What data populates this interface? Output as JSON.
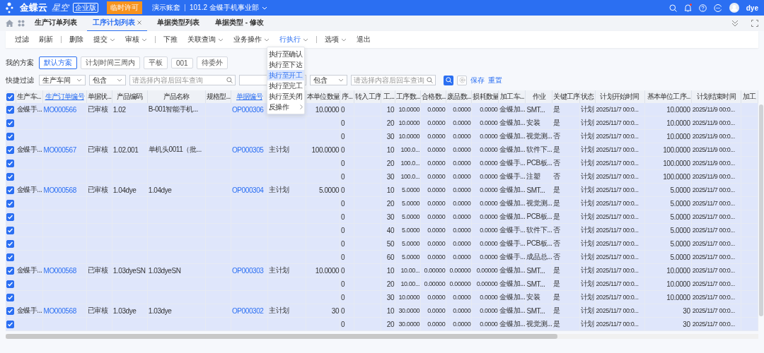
{
  "top_bar": {
    "product": "金蝶云",
    "edition": "星空",
    "badge": "企业版",
    "license_button": "临时许可",
    "account": "演示账套",
    "org": "101.2 金蝶手机事业部",
    "user": "dye",
    "notification_dot": true
  },
  "tabs": [
    {
      "label": "生产订单列表",
      "selected": false,
      "closable": false
    },
    {
      "label": "工序计划列表",
      "selected": true,
      "closable": true
    },
    {
      "label": "单据类型列表",
      "selected": false,
      "closable": false
    },
    {
      "label": "单据类型 - 修改",
      "selected": false,
      "closable": false
    }
  ],
  "toolbar": [
    {
      "kind": "button",
      "label": "过滤",
      "dropdown": false,
      "active": false
    },
    {
      "kind": "button",
      "label": "刷新",
      "dropdown": false,
      "active": false
    },
    {
      "kind": "separator"
    },
    {
      "kind": "button",
      "label": "删除",
      "dropdown": false,
      "active": false
    },
    {
      "kind": "button",
      "label": "提交",
      "dropdown": true,
      "active": false
    },
    {
      "kind": "button",
      "label": "审核",
      "dropdown": true,
      "active": false
    },
    {
      "kind": "separator"
    },
    {
      "kind": "button",
      "label": "下推",
      "dropdown": false,
      "active": false
    },
    {
      "kind": "button",
      "label": "关联查询",
      "dropdown": true,
      "active": false
    },
    {
      "kind": "button",
      "label": "业务操作",
      "dropdown": true,
      "active": false
    },
    {
      "kind": "button",
      "label": "行执行",
      "dropdown": true,
      "active": true
    },
    {
      "kind": "separator"
    },
    {
      "kind": "button",
      "label": "选项",
      "dropdown": true,
      "active": false
    },
    {
      "kind": "button",
      "label": "退出",
      "dropdown": false,
      "active": false
    }
  ],
  "dropdown_menu": {
    "items": [
      {
        "label": "执行至确认",
        "selected": false
      },
      {
        "label": "执行至下达",
        "selected": false
      },
      {
        "label": "执行至开工",
        "selected": true
      },
      {
        "label": "执行至完工",
        "selected": false
      },
      {
        "label": "执行至关闭",
        "selected": false
      },
      {
        "label": "反操作",
        "selected": false,
        "submenu": true
      }
    ]
  },
  "schemes": {
    "label": "我的方案",
    "items": [
      {
        "label": "默认方案",
        "selected": true
      },
      {
        "label": "计划时间三周内",
        "selected": false
      },
      {
        "label": "平板",
        "selected": false
      },
      {
        "label": "001",
        "selected": false
      },
      {
        "label": "待委外",
        "selected": false
      }
    ]
  },
  "quick_filter": {
    "label": "快捷过滤",
    "conditions": [
      {
        "field": "生产车间",
        "operator": "包含",
        "placeholder": "请选择内容后回车查询"
      },
      {
        "operator": "包含",
        "placeholder": "请选择内容后回车查询"
      }
    ],
    "save": "保存",
    "reset": "重置"
  },
  "table": {
    "all_checked": true,
    "columns": [
      {
        "label": "生产车..."
      },
      {
        "label": "生产订单编号",
        "link": true
      },
      {
        "label": "单据状..."
      },
      {
        "label": "产品编码"
      },
      {
        "label": "产品名称"
      },
      {
        "label": "规格型..."
      },
      {
        "label": "单据编号",
        "link": true
      },
      {},
      {
        "label": "本单位数量"
      },
      {
        "label": "序..."
      },
      {
        "label": "转入工序"
      },
      {
        "label": "工..."
      },
      {
        "label": "工序数..."
      },
      {
        "label": "合格数..."
      },
      {
        "label": "废品数..."
      },
      {
        "label": "损耗数量"
      },
      {
        "label": "加工车..."
      },
      {
        "label": "作业"
      },
      {
        "label": "关键工序"
      },
      {
        "label": "状态"
      },
      {
        "label": "计划开始时间"
      },
      {
        "label": "基本单位工序..."
      },
      {
        "label": "计划结束时间"
      },
      {
        "label": "加工"
      }
    ],
    "rows": [
      {
        "checked": true,
        "cells": [
          "金蝶手...",
          "MO000566",
          "已审核",
          "1.02",
          "B-001智能手机...",
          null,
          "OP000306",
          null,
          "10.0000",
          "0",
          null,
          "10",
          "10.0000",
          "0.0000",
          "0.0000",
          "0.0000",
          "金蝶加...",
          "SMT...",
          "是",
          "计划",
          "2025/11/7 00:0...",
          "10.0000",
          "2025/11/9 00:0..."
        ]
      },
      {
        "checked": true,
        "cells": [
          null,
          null,
          null,
          null,
          null,
          null,
          null,
          null,
          null,
          "0",
          null,
          "20",
          "10.0000",
          "0.0000",
          "0.0000",
          "0.0000",
          "金蝶加...",
          "安装",
          "是",
          "计划",
          "2025/11/7 00:0...",
          "10.0000",
          "2025/11/9 00:0..."
        ]
      },
      {
        "checked": true,
        "cells": [
          null,
          null,
          null,
          null,
          null,
          null,
          null,
          null,
          null,
          "0",
          null,
          "30",
          "10.0000",
          "0.0000",
          "0.0000",
          "0.0000",
          "金蝶加...",
          "视觉测...",
          "否",
          "计划",
          "2025/11/7 00:0...",
          "10.0000",
          "2025/11/9 00:0..."
        ]
      },
      {
        "checked": true,
        "cells": [
          "金蝶手...",
          "MO000567",
          "已审核",
          "1.02.001",
          "单机头0011（批...",
          null,
          "OP000305",
          "主计划",
          "100.0000",
          "0",
          null,
          "10",
          "100.0...",
          "0.0000",
          "0.0000",
          "0.0000",
          "金蝶加...",
          "软件下...",
          "是",
          "计划",
          "2025/11/7 00:0...",
          "100.0000",
          "2025/11/9 00:0..."
        ]
      },
      {
        "checked": true,
        "cells": [
          null,
          null,
          null,
          null,
          null,
          null,
          null,
          null,
          null,
          "0",
          null,
          "20",
          "100.0...",
          "0.0000",
          "0.0000",
          "0.0000",
          "金蝶手...",
          "PCB板...",
          "否",
          "计划",
          "2025/11/7 00:0...",
          "100.0000",
          "2025/11/9 00:0..."
        ]
      },
      {
        "checked": true,
        "cells": [
          null,
          null,
          null,
          null,
          null,
          null,
          null,
          null,
          null,
          "0",
          null,
          "30",
          "100.0...",
          "0.0000",
          "0.0000",
          "0.0000",
          "金蝶手...",
          "注塑",
          "否",
          "计划",
          "2025/11/7 00:0...",
          "100.0000",
          "2025/11/9 00:0..."
        ]
      },
      {
        "checked": true,
        "cells": [
          "金蝶手...",
          "MO000568",
          "已审核",
          "1.04dye",
          "1.04dye",
          null,
          "OP000304",
          "主计划",
          "5.0000",
          "0",
          null,
          "10",
          "5.0000",
          "0.0000",
          "0.0000",
          "0.0000",
          "金蝶加...",
          "SMT...",
          "是",
          "计划",
          "2025/11/7 00:0...",
          "5.0000",
          "2025/11/7 00:0..."
        ]
      },
      {
        "checked": true,
        "cells": [
          null,
          null,
          null,
          null,
          null,
          null,
          null,
          null,
          null,
          "0",
          null,
          "20",
          "5.0000",
          "0.0000",
          "0.0000",
          "0.0000",
          "金蝶加...",
          "视觉测...",
          "是",
          "计划",
          "2025/11/7 00:0...",
          "5.0000",
          "2025/11/7 00:0..."
        ]
      },
      {
        "checked": true,
        "cells": [
          null,
          null,
          null,
          null,
          null,
          null,
          null,
          null,
          null,
          "0",
          null,
          "30",
          "5.0000",
          "0.0000",
          "0.0000",
          "0.0000",
          "金蝶加...",
          "PCB板...",
          "是",
          "计划",
          "2025/11/7 00:0...",
          "5.0000",
          "2025/11/7 00:0..."
        ]
      },
      {
        "checked": true,
        "cells": [
          null,
          null,
          null,
          null,
          null,
          null,
          null,
          null,
          null,
          "0",
          null,
          "40",
          "5.0000",
          "0.0000",
          "0.0000",
          "0.0000",
          "金蝶手...",
          "软件下...",
          "否",
          "计划",
          "2025/11/7 00:0...",
          "5.0000",
          "2025/11/7 00:0..."
        ]
      },
      {
        "checked": true,
        "cells": [
          null,
          null,
          null,
          null,
          null,
          null,
          null,
          null,
          null,
          "0",
          null,
          "50",
          "5.0000",
          "0.0000",
          "0.0000",
          "0.0000",
          "金蝶手...",
          "PCB板...",
          "否",
          "计划",
          "2025/11/7 00:0...",
          "5.0000",
          "2025/11/7 00:0..."
        ]
      },
      {
        "checked": true,
        "cells": [
          null,
          null,
          null,
          null,
          null,
          null,
          null,
          null,
          null,
          "0",
          null,
          "60",
          "5.0000",
          "0.0000",
          "0.0000",
          "0.0000",
          "金蝶手...",
          "成品总...",
          "否",
          "计划",
          "2025/11/7 00:0...",
          "5.0000",
          "2025/11/7 00:0..."
        ]
      },
      {
        "checked": true,
        "cells": [
          "金蝶手...",
          "MO000568",
          "已审核",
          "1.03dyeSN",
          "1.03dyeSN",
          null,
          "OP000303",
          "主计划",
          "10.0000",
          "0",
          null,
          "10",
          "10.00...",
          "0.00000",
          "0.00000",
          "0.00000",
          "金蝶加...",
          "SMT...",
          "是",
          "计划",
          "2025/11/7 00:0...",
          "10.0000",
          "2025/11/7 00:0..."
        ]
      },
      {
        "checked": true,
        "cells": [
          null,
          null,
          null,
          null,
          null,
          null,
          null,
          null,
          null,
          "0",
          null,
          "20",
          "10.00...",
          "0.00000",
          "0.00000",
          "0.00000",
          "金蝶加...",
          "SMT...",
          "是",
          "计划",
          "2025/11/7 00:0...",
          "10.0000",
          "2025/11/7 00:0..."
        ]
      },
      {
        "checked": true,
        "cells": [
          null,
          null,
          null,
          null,
          null,
          null,
          null,
          null,
          null,
          "0",
          null,
          "30",
          "10.0000",
          "0.0000",
          "0.0000",
          "0.0000",
          "金蝶加...",
          "安装",
          "是",
          "计划",
          "2025/11/7 00:0...",
          "10.0000",
          "2025/11/7 00:0..."
        ]
      },
      {
        "checked": true,
        "cells": [
          "金蝶手...",
          "MO000568",
          "已审核",
          "1.03dye",
          "1.03dye",
          null,
          "OP000302",
          "主计划",
          "30",
          "0",
          null,
          "10",
          "30.0000",
          "0.0000",
          "0.0000",
          "0.0000",
          "金蝶加...",
          "SMT...",
          "是",
          "计划",
          "2025/11/7 00:0...",
          "30",
          "2025/11/7 00:0..."
        ]
      },
      {
        "checked": true,
        "cells": [
          null,
          null,
          null,
          null,
          null,
          null,
          null,
          null,
          null,
          "0",
          null,
          "20",
          "30.0000",
          "0.0000",
          "0.0000",
          "0.0000",
          "金蝶加...",
          "视觉测...",
          "是",
          "计划",
          "2025/11/7 00:0...",
          "30",
          "2025/11/7 00:0..."
        ]
      }
    ]
  }
}
